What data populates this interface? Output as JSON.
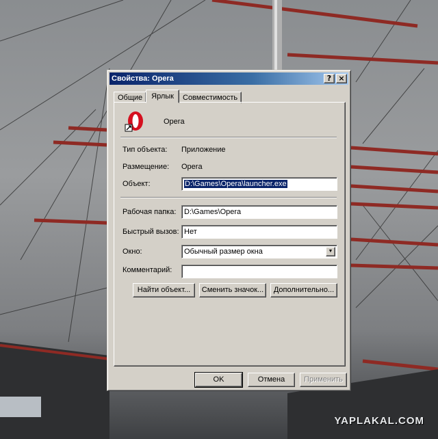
{
  "window": {
    "title": "Свойства: Opera",
    "help_button": "?",
    "close_button": "×"
  },
  "tabs": [
    {
      "label": "Общие"
    },
    {
      "label": "Ярлык"
    },
    {
      "label": "Совместимость"
    }
  ],
  "shortcut": {
    "app_name": "Opera",
    "icon": "opera-shortcut-icon",
    "type_label": "Тип объекта:",
    "type_value": "Приложение",
    "location_label": "Размещение:",
    "location_value": "Opera",
    "target_label": "Объект:",
    "target_value": "D:\\Games\\Opera\\launcher.exe",
    "workdir_label": "Рабочая папка:",
    "workdir_value": "D:\\Games\\Opera",
    "hotkey_label": "Быстрый вызов:",
    "hotkey_value": "Нет",
    "window_label": "Окно:",
    "window_value": "Обычный размер окна",
    "comment_label": "Комментарий:",
    "comment_value": "",
    "find_target_button": "Найти объект...",
    "change_icon_button": "Сменить значок...",
    "advanced_button": "Дополнительно..."
  },
  "footer": {
    "ok": "OK",
    "cancel": "Отмена",
    "apply": "Применить"
  },
  "watermark": "YAPLAKAL.COM",
  "colors": {
    "titlebar_start": "#0a246a",
    "titlebar_end": "#a6caf0",
    "dialog_face": "#d4d0c8",
    "opera_red": "#d5101f"
  }
}
